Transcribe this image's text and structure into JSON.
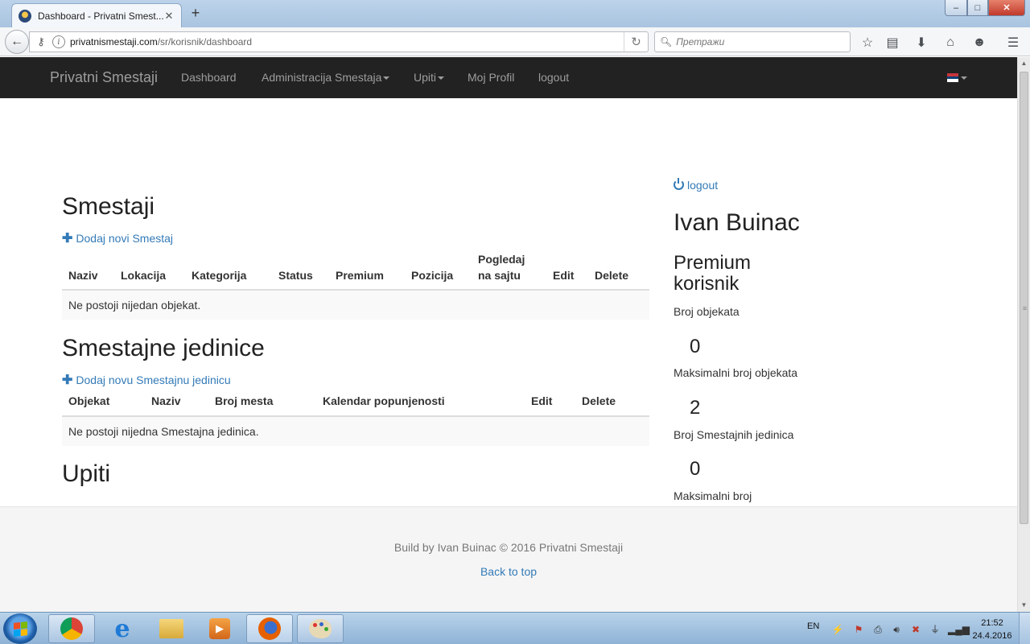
{
  "browser": {
    "tab_title": "Dashboard - Privatni Smest...",
    "tab_close": "✕",
    "new_tab": "+",
    "url_host": "privatnismestaji.com",
    "url_path": "/sr/korisnik/dashboard",
    "search_placeholder": "Претражи",
    "window_min": "–",
    "window_max": "□",
    "window_close": "✕"
  },
  "site": {
    "brand": "Privatni Smestaji",
    "nav": {
      "dashboard": "Dashboard",
      "administracija": "Administracija Smestaja",
      "upiti": "Upiti",
      "profil": "Moj Profil",
      "logout": "logout"
    },
    "flag_colors": [
      "#c6363c",
      "#0c4076",
      "#ffffff"
    ]
  },
  "smestaji": {
    "title": "Smestaji",
    "add_link": "Dodaj novi Smestaj",
    "columns": [
      "Naziv",
      "Lokacija",
      "Kategorija",
      "Status",
      "Premium",
      "Pozicija",
      "Pogledaj",
      "na sajtu",
      "Edit",
      "Delete"
    ],
    "empty": "Ne postoji nijedan objekat."
  },
  "jedinice": {
    "title": "Smestajne jedinice",
    "add_link": "Dodaj novu Smestajnu jedinicu",
    "columns": [
      "Objekat",
      "Naziv",
      "Broj mesta",
      "Kalendar popunjenosti",
      "Edit",
      "Delete"
    ],
    "empty": "Ne postoji nijedna Smestajna jedinica."
  },
  "upiti": {
    "title": "Upiti"
  },
  "sidebar": {
    "logout": "logout",
    "user_name": "Ivan Buinac",
    "user_type": "Premium korisnik",
    "stats": [
      {
        "label": "Broj objekata",
        "value": "0"
      },
      {
        "label": "Maksimalni broj objekata",
        "value": "2"
      },
      {
        "label": "Broj Smestajnih jedinica",
        "value": "0"
      },
      {
        "label": "Maksimalni broj",
        "value": ""
      }
    ]
  },
  "footer": {
    "credit": "Build by Ivan Buinac © 2016 Privatni Smestaji",
    "back_to_top": "Back to top"
  },
  "taskbar": {
    "language": "EN",
    "time": "21:52",
    "date": "24.4.2016"
  },
  "colors": {
    "link": "#337ab7",
    "navbar_bg": "#222222",
    "footer_bg": "#f5f5f5"
  }
}
